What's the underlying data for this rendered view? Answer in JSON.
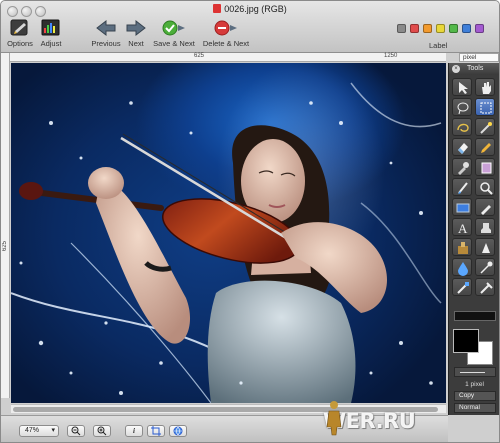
{
  "window": {
    "title": "0026.jpg (RGB)"
  },
  "toolbar": {
    "buttons": [
      {
        "id": "options",
        "label": "Options",
        "icon": "options-icon"
      },
      {
        "id": "adjust",
        "label": "Adjust",
        "icon": "adjust-icon"
      },
      {
        "id": "previous",
        "label": "Previous",
        "icon": "arrow-left-icon"
      },
      {
        "id": "next",
        "label": "Next",
        "icon": "arrow-right-icon"
      },
      {
        "id": "save_next",
        "label": "Save & Next",
        "icon": "save-check-icon"
      },
      {
        "id": "delete_next",
        "label": "Delete & Next",
        "icon": "delete-icon"
      }
    ],
    "label_text": "Label",
    "label_colors": [
      "#8a8a8a",
      "#e04b4b",
      "#f29a2e",
      "#e8d73a",
      "#53b84a",
      "#3f7fd9",
      "#a35bd0"
    ]
  },
  "ruler": {
    "top_ticks": [
      "625",
      "1250"
    ],
    "left_tick": "625",
    "unit": "pixel"
  },
  "tools_palette": {
    "title": "Tools",
    "tools": [
      "arrow-select-icon",
      "hand-pan-icon",
      "lasso-icon",
      "rect-select-icon",
      "lasso-freeform-icon",
      "magic-wand-icon",
      "eraser-icon",
      "pencil-icon",
      "dropper-icon",
      "crop-icon",
      "brush-icon",
      "zoom-icon",
      "rectangle-shape-icon",
      "smudge-icon",
      "text-icon",
      "stamp-icon",
      "clone-icon",
      "sharpen-icon",
      "water-drop-icon",
      "burn-icon",
      "blur-icon",
      "paint-bucket-icon"
    ],
    "line_width": "1 pixel",
    "copy_mode": "Copy",
    "blend_mode": "Normal",
    "foreground_color": "#000000",
    "background_color": "#ffffff"
  },
  "statusbar": {
    "zoom": "47%",
    "zoom_out_icon": "zoom-out-icon",
    "zoom_in_icon": "zoom-in-icon",
    "info_icon": "info-icon",
    "crop_icon": "crop-icon",
    "web_icon": "globe-icon"
  },
  "watermark": "WER.RU"
}
